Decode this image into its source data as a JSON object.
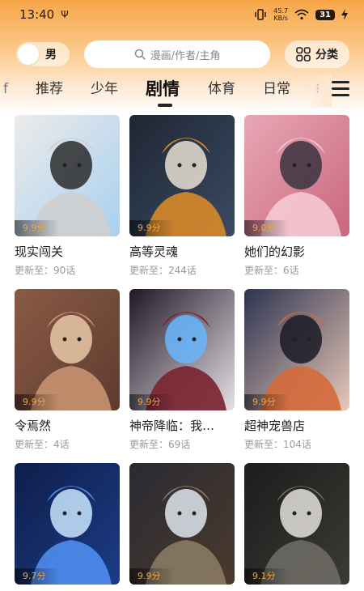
{
  "status_bar": {
    "time": "13:40",
    "usb_glyph": "Ψ",
    "net_speed_value": "45.7",
    "net_speed_unit": "KB/s",
    "battery": "31"
  },
  "header": {
    "gender_label": "男",
    "search_placeholder": "漫画/作者/主角",
    "category_label": "分类"
  },
  "tabs": [
    {
      "label": "f"
    },
    {
      "label": "推荐"
    },
    {
      "label": "少年"
    },
    {
      "label": "剧情",
      "active": true
    },
    {
      "label": "体育"
    },
    {
      "label": "日常"
    },
    {
      "label": "⁝"
    }
  ],
  "comics": [
    {
      "title": "现实闯关",
      "rating": "9.9分",
      "update": "更新至：90话",
      "palette": [
        "#ecebea",
        "#cfcfcf",
        "#2b2b2b",
        "#a8d0f0"
      ]
    },
    {
      "title": "高等灵魂",
      "rating": "9.9分",
      "update": "更新至：244话",
      "palette": [
        "#1e2633",
        "#d88a2a",
        "#e8e0d2",
        "#3b4b63"
      ]
    },
    {
      "title": "她们的幻影",
      "rating": "9.0分",
      "update": "更新至：6话",
      "palette": [
        "#e8a7b6",
        "#f5c9d3",
        "#3a3340",
        "#c9677c"
      ]
    },
    {
      "title": "令焉然",
      "rating": "9.9分",
      "update": "更新至：4话",
      "palette": [
        "#8a5a45",
        "#c99270",
        "#e8c9a8",
        "#5e3b2e"
      ]
    },
    {
      "title": "神帝降临：我…",
      "rating": "9.9分",
      "update": "更新至：69话",
      "palette": [
        "#1f1726",
        "#7a2230",
        "#69b6ff",
        "#e7e1e6"
      ]
    },
    {
      "title": "超神宠兽店",
      "rating": "9.9分",
      "update": "更新至：104话",
      "palette": [
        "#2d3350",
        "#d46a3a",
        "#1a1a24",
        "#e8c8b8"
      ]
    },
    {
      "title": "",
      "rating": "9.7分",
      "update": "",
      "palette": [
        "#0e1e4a",
        "#4f8df0",
        "#c8e6ff",
        "#1c3c86"
      ]
    },
    {
      "title": "",
      "rating": "9.9分",
      "update": "",
      "palette": [
        "#2a2a33",
        "#8a7a64",
        "#dfe6ee",
        "#4a3a2c"
      ]
    },
    {
      "title": "",
      "rating": "9.1分",
      "update": "",
      "palette": [
        "#1d1c1b",
        "#6d6a64",
        "#e3e0da",
        "#3c3a36"
      ]
    }
  ],
  "colors": {
    "accent_orange": "#f7a647",
    "rating_orange": "#f3a33a"
  }
}
